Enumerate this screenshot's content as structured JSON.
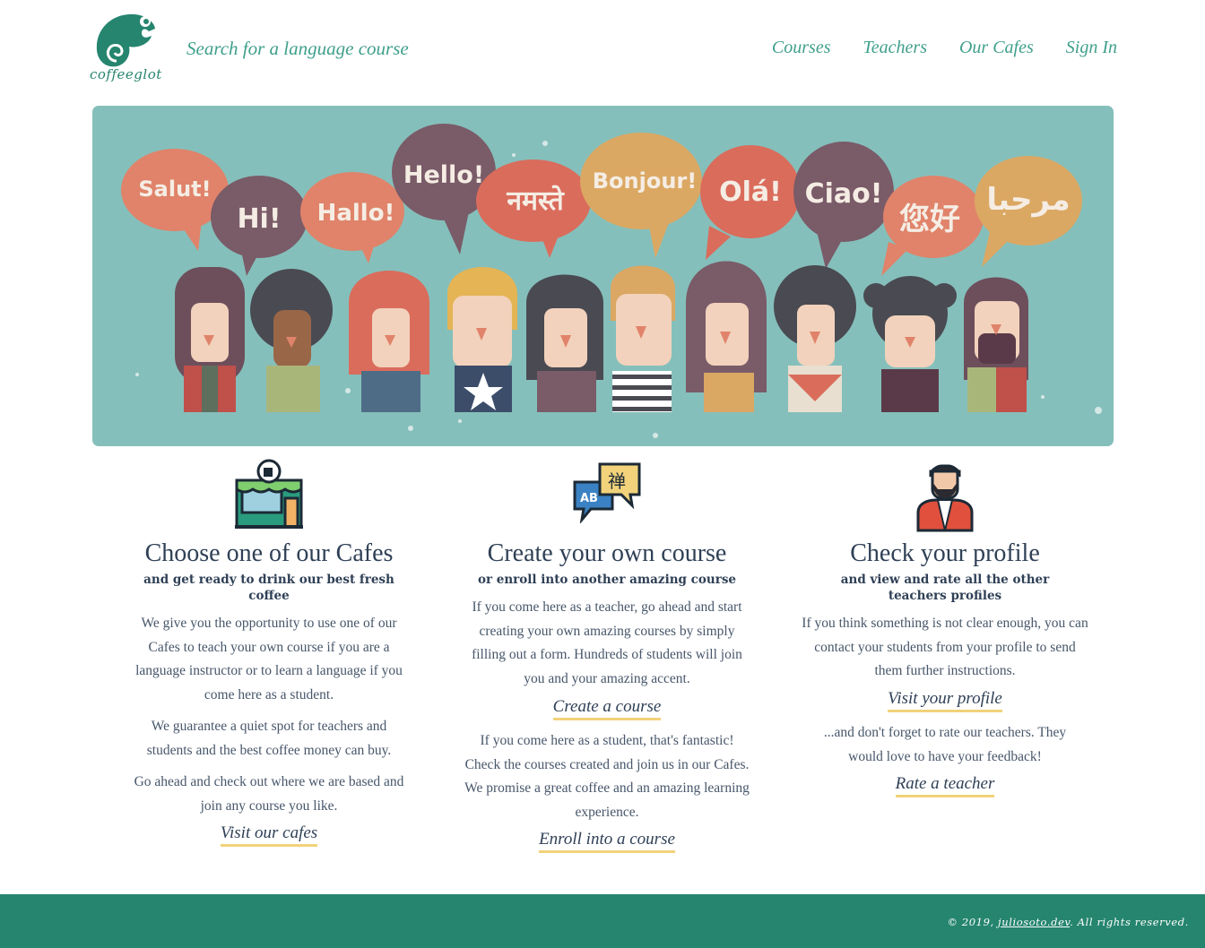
{
  "header": {
    "brand": "coffeeglot",
    "search_link": "Search for a language course",
    "nav": [
      "Courses",
      "Teachers",
      "Our Cafes",
      "Sign In"
    ]
  },
  "hero": {
    "greetings": [
      "Salut!",
      "Hi!",
      "Hallo!",
      "Hello!",
      "नमस्ते",
      "Bonjour!",
      "Olá!",
      "Ciao!",
      "您好",
      "مرحبا"
    ]
  },
  "features": [
    {
      "icon": "cafe-icon",
      "title": "Choose one of our Cafes",
      "subtitle": "and get ready to drink our best fresh coffee",
      "paragraphs": [
        "We give you the opportunity to use one of our Cafes to teach your own course if you are a language instructor or to learn a language if you come here as a student.",
        "We guarantee a quiet spot for teachers and students and the best coffee money can buy.",
        "Go ahead and check out where we are based and join any course you like."
      ],
      "link": "Visit our cafes"
    },
    {
      "icon": "translate-icon",
      "title": "Create your own course",
      "subtitle": "or enroll into another amazing course",
      "paragraphs": [
        "If you come here as a teacher, go ahead and start creating your own amazing courses by simply filling out a form. Hundreds of students will join you and your amazing accent.",
        "If you come here as a student, that's fantastic! Check the courses created and join us in our Cafes. We promise a great coffee and an amazing learning experience."
      ],
      "links": [
        "Create a course",
        "Enroll into a course"
      ]
    },
    {
      "icon": "teacher-icon",
      "title": "Check your profile",
      "subtitle": "and view and rate all the other teachers profiles",
      "paragraphs": [
        "If you think something is not clear enough, you can contact your students from your profile to send them further instructions.",
        "...and don't forget to rate our teachers. They would love to have your feedback!"
      ],
      "links": [
        "Visit your profile",
        "Rate a teacher"
      ]
    }
  ],
  "footer": {
    "copyright_prefix": "© 2019, ",
    "author_link": "juliosoto.dev",
    "copyright_suffix": ". All rights reserved."
  },
  "colors": {
    "brand": "#26856f",
    "nav_text": "#3f9f8b",
    "hero_bg": "#85bfbb",
    "link_underline": "#f2d27a"
  }
}
